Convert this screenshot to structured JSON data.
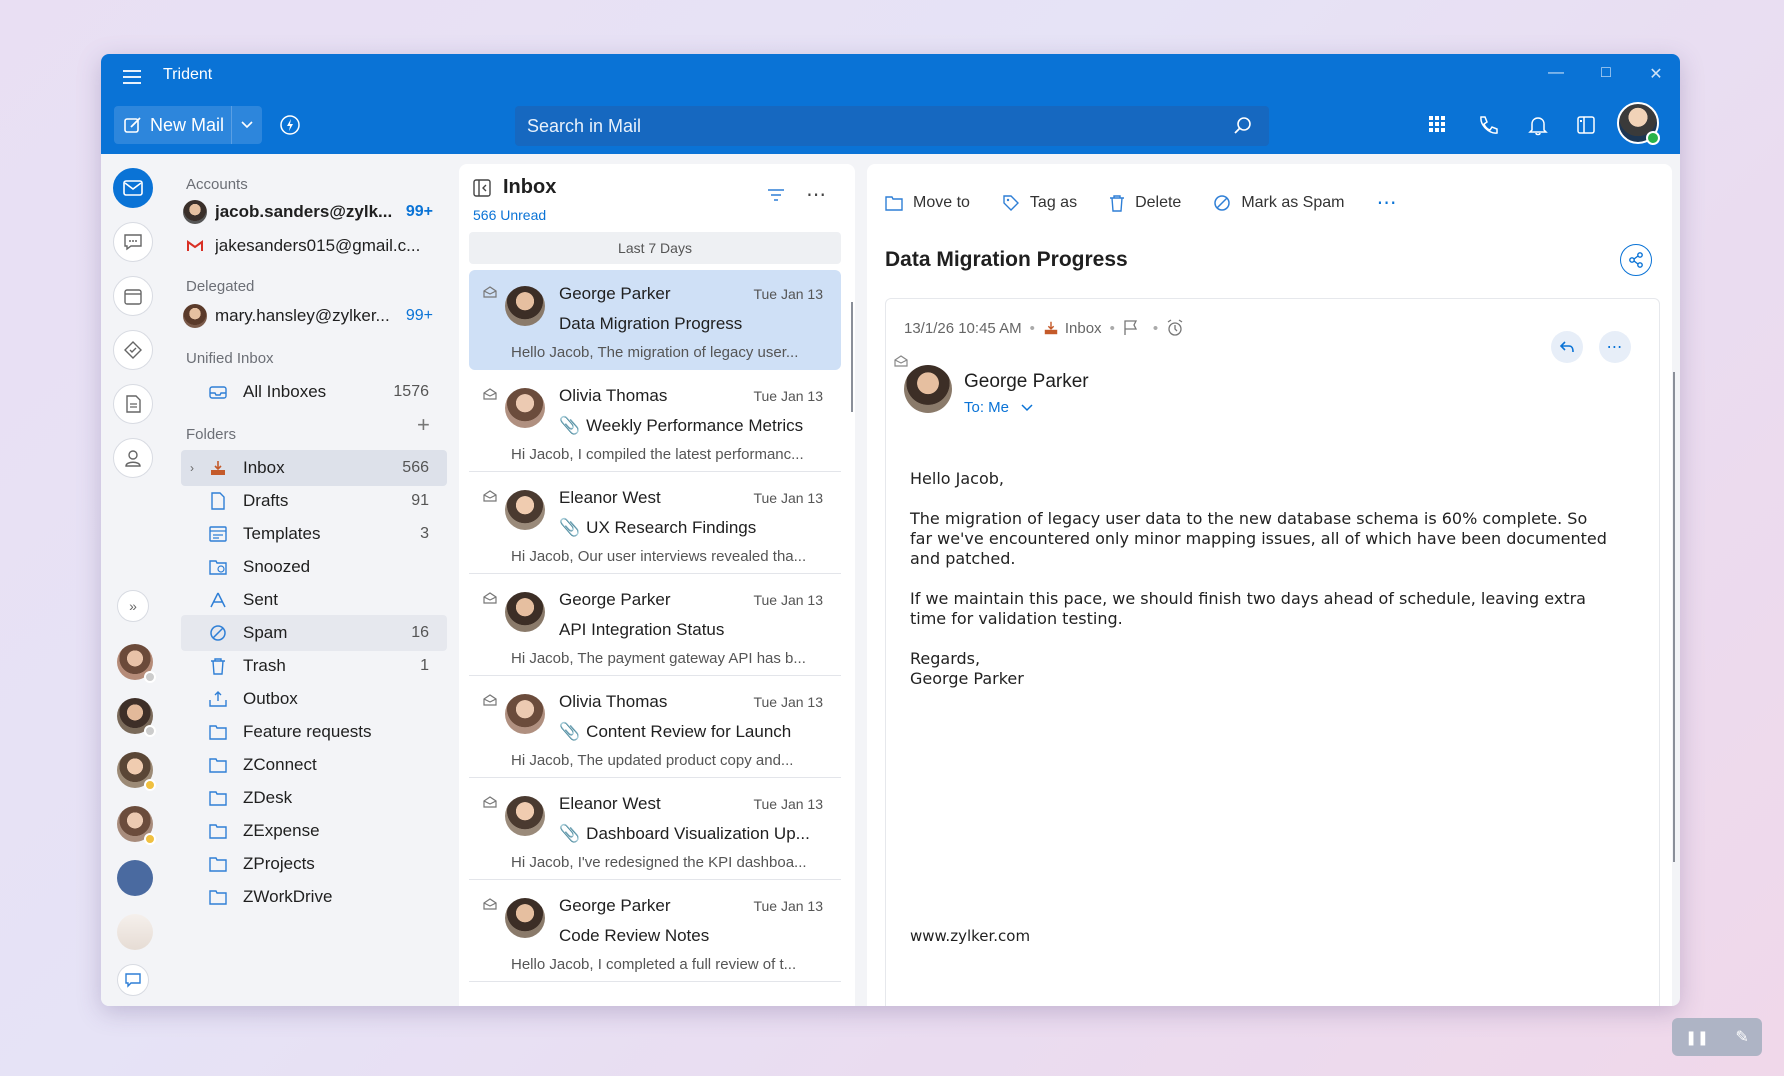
{
  "app": {
    "title": "Trident"
  },
  "toolbar": {
    "new_mail": "New Mail",
    "search_placeholder": "Search in Mail"
  },
  "accounts": {
    "section_label": "Accounts",
    "items": [
      {
        "label": "jacob.sanders@zylk...",
        "count": "99+"
      },
      {
        "label": "jakesanders015@gmail.c...",
        "count": ""
      }
    ],
    "delegated_label": "Delegated",
    "delegated": [
      {
        "label": "mary.hansley@zylker...",
        "count": "99+"
      }
    ]
  },
  "unified": {
    "section_label": "Unified Inbox",
    "all_inboxes": "All Inboxes",
    "all_count": "1576"
  },
  "folders": {
    "section_label": "Folders",
    "items": [
      {
        "label": "Inbox",
        "count": "566",
        "icon": "inbox-icon"
      },
      {
        "label": "Drafts",
        "count": "91",
        "icon": "draft-icon"
      },
      {
        "label": "Templates",
        "count": "3",
        "icon": "template-icon"
      },
      {
        "label": "Snoozed",
        "count": "",
        "icon": "snooze-icon"
      },
      {
        "label": "Sent",
        "count": "",
        "icon": "sent-icon"
      },
      {
        "label": "Spam",
        "count": "16",
        "icon": "spam-icon"
      },
      {
        "label": "Trash",
        "count": "1",
        "icon": "trash-icon"
      },
      {
        "label": "Outbox",
        "count": "",
        "icon": "outbox-icon"
      },
      {
        "label": "Feature requests",
        "count": "",
        "icon": "folder-icon"
      },
      {
        "label": "ZConnect",
        "count": "",
        "icon": "folder-icon"
      },
      {
        "label": "ZDesk",
        "count": "",
        "icon": "folder-icon"
      },
      {
        "label": "ZExpense",
        "count": "",
        "icon": "folder-icon"
      },
      {
        "label": "ZProjects",
        "count": "",
        "icon": "folder-icon"
      },
      {
        "label": "ZWorkDrive",
        "count": "",
        "icon": "folder-icon"
      }
    ]
  },
  "list": {
    "title": "Inbox",
    "unread": "566 Unread",
    "group": "Last 7 Days",
    "messages": [
      {
        "from": "George Parker",
        "date": "Tue Jan 13",
        "subject": "Data Migration Progress",
        "preview": "Hello Jacob, The migration of legacy user...",
        "attachment": false
      },
      {
        "from": "Olivia Thomas",
        "date": "Tue Jan 13",
        "subject": "Weekly Performance Metrics",
        "preview": "Hi Jacob, I compiled the latest performanc...",
        "attachment": true
      },
      {
        "from": "Eleanor West",
        "date": "Tue Jan 13",
        "subject": "UX Research Findings",
        "preview": "Hi Jacob, Our user interviews revealed tha...",
        "attachment": true
      },
      {
        "from": "George Parker",
        "date": "Tue Jan 13",
        "subject": "API Integration Status",
        "preview": "Hi Jacob, The payment gateway API has b...",
        "attachment": false
      },
      {
        "from": "Olivia Thomas",
        "date": "Tue Jan 13",
        "subject": "Content Review for Launch",
        "preview": "Hi Jacob, The updated product copy and...",
        "attachment": true
      },
      {
        "from": "Eleanor West",
        "date": "Tue Jan 13",
        "subject": "Dashboard Visualization Up...",
        "preview": "Hi Jacob, I've redesigned the KPI dashboa...",
        "attachment": true
      },
      {
        "from": "George Parker",
        "date": "Tue Jan 13",
        "subject": "Code Review Notes",
        "preview": "Hello Jacob, I completed a full review of t...",
        "attachment": false
      }
    ]
  },
  "reader": {
    "actions": {
      "move": "Move to",
      "tag": "Tag as",
      "delete": "Delete",
      "spam": "Mark as Spam"
    },
    "subject": "Data Migration Progress",
    "datetime": "13/1/26 10:45 AM",
    "folder": "Inbox",
    "sender": "George Parker",
    "to": "To: Me",
    "greeting": "Hello Jacob,",
    "para1": "The migration of legacy user data to the new database schema is 60% complete. So far we've encountered only minor mapping issues, all of which have been documented and patched.",
    "para2": "If we maintain this pace, we should finish two days ahead of schedule, leaving extra time for validation testing.",
    "regards": "Regards,",
    "signature": "George Parker",
    "url": "www.zylker.com"
  },
  "colors": {
    "accent": "#0a73d6",
    "selected_row": "#cfe0f6"
  }
}
